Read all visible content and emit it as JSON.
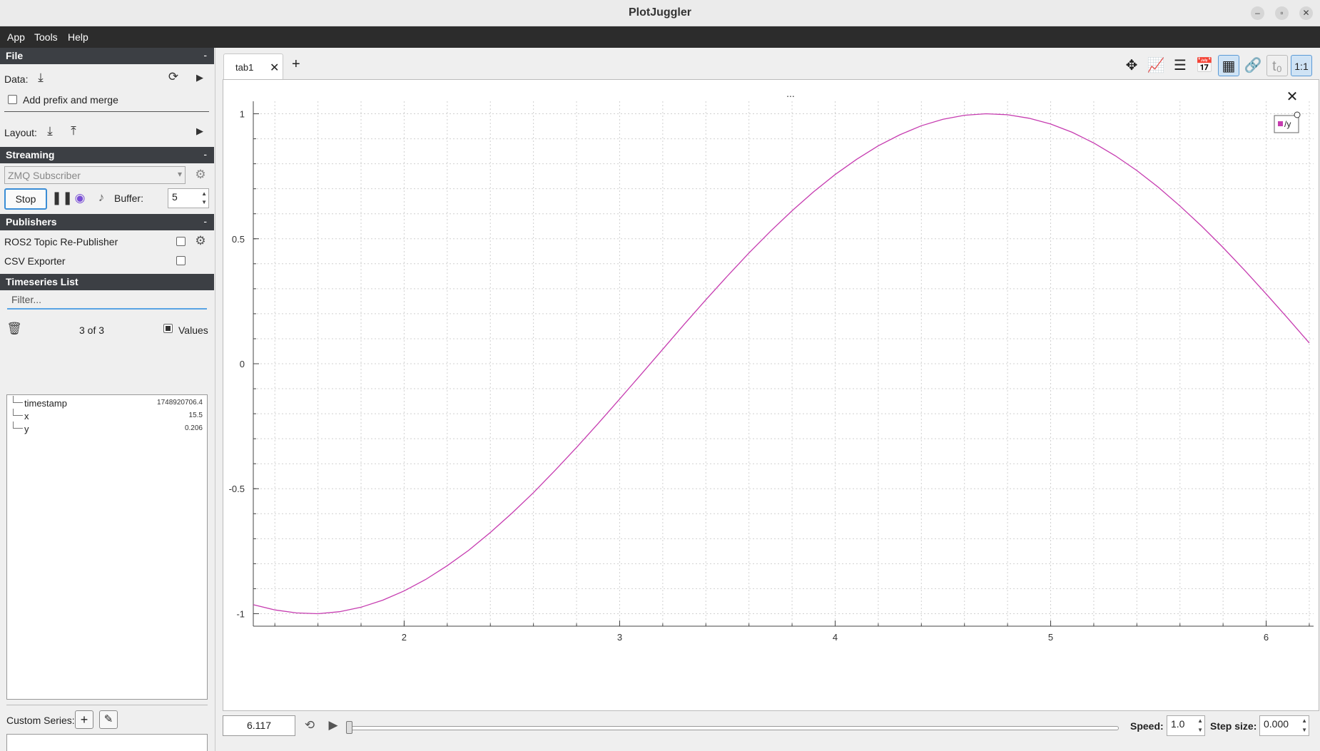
{
  "window": {
    "title": "PlotJuggler"
  },
  "menu": [
    "App",
    "Tools",
    "Help"
  ],
  "file_section": {
    "header": "File",
    "collapse": "-",
    "data_label": "Data:",
    "prefix_label": "Add prefix and merge",
    "layout_label": "Layout:"
  },
  "streaming": {
    "header": "Streaming",
    "collapse": "-",
    "source": "ZMQ Subscriber",
    "stop_label": "Stop",
    "buffer_label": "Buffer:",
    "buffer_value": "5"
  },
  "publishers": {
    "header": "Publishers",
    "collapse": "-",
    "items": [
      "ROS2 Topic Re-Publisher",
      "CSV Exporter"
    ]
  },
  "timeseries": {
    "header": "Timeseries List",
    "filter_placeholder": "Filter...",
    "count": "3 of 3",
    "values_label": "Values",
    "rows": [
      {
        "name": "timestamp",
        "value": "1748920706.4"
      },
      {
        "name": "x",
        "value": "15.5"
      },
      {
        "name": "y",
        "value": "0.206"
      }
    ]
  },
  "custom_series": {
    "label": "Custom Series:"
  },
  "tabs": [
    {
      "label": "tab1"
    }
  ],
  "plot": {
    "title": "...",
    "legend": "y",
    "line_color": "#c63cb0"
  },
  "chart_data": {
    "type": "line",
    "series": [
      {
        "name": "y",
        "x_range": [
          1.3,
          6.2
        ],
        "formula_note": "",
        "x": [
          1.3,
          1.4,
          1.5,
          1.6,
          1.7,
          1.8,
          1.9,
          2.0,
          2.1,
          2.2,
          2.3,
          2.4,
          2.5,
          2.6,
          2.7,
          2.8,
          2.9,
          3.0,
          3.1,
          3.2,
          3.3,
          3.4,
          3.5,
          3.6,
          3.7,
          3.8,
          3.9,
          4.0,
          4.1,
          4.2,
          4.3,
          4.4,
          4.5,
          4.6,
          4.7,
          4.8,
          4.9,
          5.0,
          5.1,
          5.2,
          5.3,
          5.4,
          5.5,
          5.6,
          5.7,
          5.8,
          5.9,
          6.0,
          6.1,
          6.2
        ],
        "y": [
          -0.964,
          -0.985,
          -0.997,
          -1.0,
          -0.992,
          -0.974,
          -0.946,
          -0.909,
          -0.863,
          -0.808,
          -0.746,
          -0.675,
          -0.598,
          -0.516,
          -0.427,
          -0.335,
          -0.239,
          -0.141,
          -0.042,
          0.058,
          0.158,
          0.256,
          0.351,
          0.443,
          0.53,
          0.612,
          0.688,
          0.757,
          0.818,
          0.872,
          0.916,
          0.952,
          0.978,
          0.994,
          1.0,
          0.996,
          0.982,
          0.959,
          0.926,
          0.883,
          0.832,
          0.773,
          0.706,
          0.631,
          0.551,
          0.465,
          0.374,
          0.279,
          0.182,
          0.083
        ]
      }
    ],
    "x_ticks": [
      2,
      3,
      4,
      5,
      6
    ],
    "y_ticks": [
      1,
      0.5,
      0,
      -0.5,
      -1
    ],
    "x_tick_labels": [
      "2",
      "3",
      "4",
      "5",
      "6"
    ],
    "y_tick_labels": [
      "1",
      "0.5",
      "0",
      "-0.5",
      "-1"
    ],
    "xlim": [
      1.3,
      6.22
    ],
    "ylim": [
      -1.05,
      1.05
    ],
    "grid": true,
    "legend_position": "top-right"
  },
  "playback": {
    "time_value": "6.117",
    "speed_label": "Speed:",
    "speed_value": "1.0",
    "step_label": "Step size:",
    "step_value": "0.000"
  }
}
